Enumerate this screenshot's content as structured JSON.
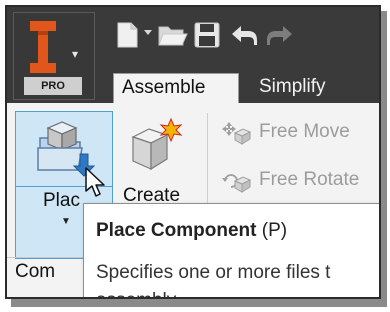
{
  "app": {
    "logo_letter": "I",
    "logo_badge": "PRO"
  },
  "quick_access": {
    "icons": [
      "new-icon",
      "new-dropdown-icon",
      "open-icon",
      "save-icon",
      "undo-icon",
      "redo-icon"
    ]
  },
  "tabs": [
    {
      "label": "Assemble",
      "active": true
    },
    {
      "label": "Simplify",
      "active": false
    }
  ],
  "ribbon": {
    "place_label": "Plac",
    "create_label": "Create",
    "free_move_label": "Free Move",
    "free_rotate_label": "Free Rotate",
    "panel_label": "Com"
  },
  "tooltip": {
    "title": "Place Component",
    "shortcut": " (P)",
    "description": "Specifies one or more files t",
    "description_cont": "assembly"
  },
  "colors": {
    "titlebar": "#3a3a3a",
    "highlight_fill": "#cfe6f7",
    "highlight_border": "#4f9ed6",
    "logo_orange": "#e0561b",
    "disabled_text": "#9c9c9c"
  }
}
